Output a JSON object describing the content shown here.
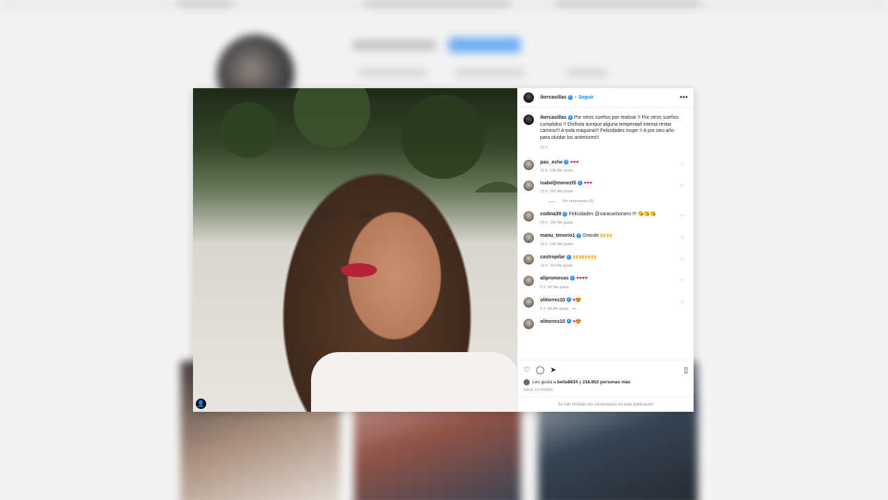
{
  "post": {
    "author": "ikercasillas",
    "follow_label": "Seguir",
    "separator": "•",
    "more_label": "•••",
    "caption": "Por otros sueños por realizar !! Por otros sueños cumplidos !! Disfruta aunque alguna tempestad intenta restar camino!!! A toda máquina!!! Felicidades mujer !! A por otro año para olvidar los anteriores!!",
    "caption_time": "13 h"
  },
  "comments": [
    {
      "user": "pau_eche",
      "text": "♥♥♥",
      "time": "13 h",
      "likes": "239 Me gusta"
    },
    {
      "user": "isabeljimenezt5",
      "text": "♥♥♥",
      "time": "13 h",
      "likes": "291 Me gusta",
      "replies": "Ver respuestas (3)"
    },
    {
      "user": "codina30",
      "text": "Felicidades @saracarbonero !!! 😘😘😘",
      "time": "13 h",
      "likes": "156 Me gusta"
    },
    {
      "user": "manu_tenorio1",
      "text": "Grande 🙌🙌",
      "time": "13 h",
      "likes": "149 Me gusta"
    },
    {
      "user": "castropilar",
      "text": "🙌🙌🙌🙌",
      "time": "13 h",
      "likes": "119 Me gusta"
    },
    {
      "user": "alipromesas",
      "text": "♥♥♥♥",
      "time": "6 h",
      "likes": "39 Me gusta"
    },
    {
      "user": "olitorres10",
      "text": "♥😍",
      "time": "5 h",
      "likes": "54 Me gusta",
      "extra": "•••"
    },
    {
      "user": "olitorres10",
      "text": "♥😍",
      "time": "",
      "likes": ""
    }
  ],
  "likes": {
    "prefix": "Les gusta a",
    "user": "beita8834",
    "middle": "y",
    "count": "218.852 personas más"
  },
  "time_ago": "HACE 13 HORAS",
  "comments_limited": "Se han limitado los comentarios en esta publicación",
  "icons": [
    "heart-icon",
    "comment-icon",
    "share-icon",
    "bookmark-icon",
    "user-tag-icon"
  ],
  "colors": {
    "link": "#0095f6",
    "verified": "#3897f0",
    "heart_red": "#e0245e"
  }
}
